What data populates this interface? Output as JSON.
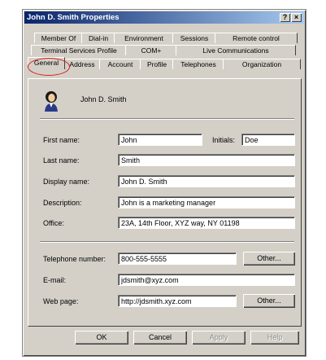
{
  "window": {
    "title": "John D. Smith Properties",
    "help_glyph": "?",
    "close_glyph": "×"
  },
  "tabs": {
    "row1": [
      "Member Of",
      "Dial-in",
      "Environment",
      "Sessions",
      "Remote control"
    ],
    "row2": [
      "Terminal Services Profile",
      "COM+",
      "Live Communications"
    ],
    "row3": [
      "General",
      "Address",
      "Account",
      "Profile",
      "Telephones",
      "Organization"
    ],
    "active": "General"
  },
  "general": {
    "display_name_header": "John D. Smith",
    "first_name_label": "First name:",
    "first_name_value": "John",
    "initials_label": "Initials:",
    "initials_value": "Doe",
    "last_name_label": "Last name:",
    "last_name_value": "Smith",
    "display_name_label": "Display name:",
    "display_name_value": "John D. Smith",
    "description_label": "Description:",
    "description_value": "John is a marketing manager",
    "office_label": "Office:",
    "office_value": "23A, 14th Floor, XYZ way, NY 01198",
    "telephone_label": "Telephone number:",
    "telephone_value": "800-555-5555",
    "telephone_other": "Other...",
    "email_label": "E-mail:",
    "email_value": "jdsmith@xyz.com",
    "webpage_label": "Web page:",
    "webpage_value": "http://jdsmith.xyz.com",
    "webpage_other": "Other..."
  },
  "footer": {
    "ok": "OK",
    "cancel": "Cancel",
    "apply": "Apply",
    "help": "Help"
  }
}
